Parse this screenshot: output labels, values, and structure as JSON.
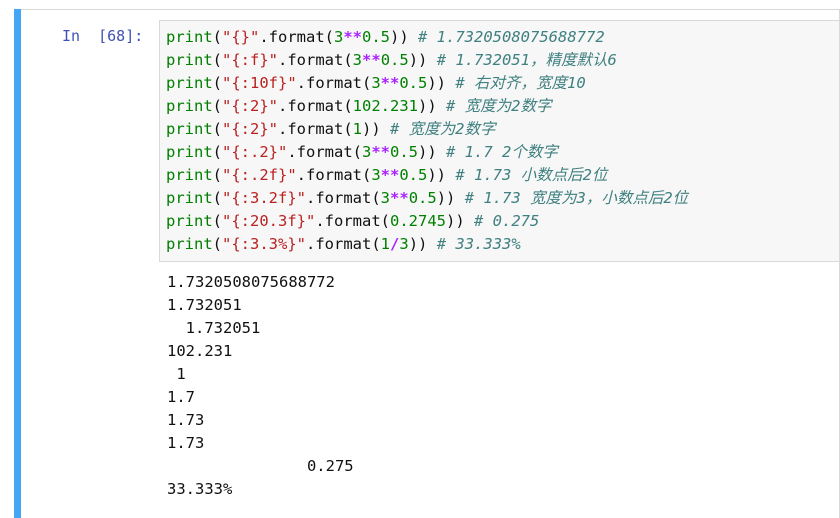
{
  "cell": {
    "prompt": "In  [68]:",
    "code_lines": [
      {
        "segments": [
          {
            "text": "print",
            "cls": "kw"
          },
          {
            "text": "(",
            "cls": ""
          },
          {
            "text": "\"{}\"",
            "cls": "str"
          },
          {
            "text": ".format(",
            "cls": ""
          },
          {
            "text": "3",
            "cls": "num"
          },
          {
            "text": "**",
            "cls": "op"
          },
          {
            "text": "0.5",
            "cls": "num"
          },
          {
            "text": ")) ",
            "cls": ""
          },
          {
            "text": "# 1.7320508075688772",
            "cls": "cm"
          }
        ]
      },
      {
        "segments": [
          {
            "text": "print",
            "cls": "kw"
          },
          {
            "text": "(",
            "cls": ""
          },
          {
            "text": "\"{:f}\"",
            "cls": "str"
          },
          {
            "text": ".format(",
            "cls": ""
          },
          {
            "text": "3",
            "cls": "num"
          },
          {
            "text": "**",
            "cls": "op"
          },
          {
            "text": "0.5",
            "cls": "num"
          },
          {
            "text": ")) ",
            "cls": ""
          },
          {
            "text": "# 1.732051，精度默认6",
            "cls": "cm"
          }
        ]
      },
      {
        "segments": [
          {
            "text": "print",
            "cls": "kw"
          },
          {
            "text": "(",
            "cls": ""
          },
          {
            "text": "\"{:10f}\"",
            "cls": "str"
          },
          {
            "text": ".format(",
            "cls": ""
          },
          {
            "text": "3",
            "cls": "num"
          },
          {
            "text": "**",
            "cls": "op"
          },
          {
            "text": "0.5",
            "cls": "num"
          },
          {
            "text": ")) ",
            "cls": ""
          },
          {
            "text": "# 右对齐，宽度10",
            "cls": "cm"
          }
        ]
      },
      {
        "segments": [
          {
            "text": "print",
            "cls": "kw"
          },
          {
            "text": "(",
            "cls": ""
          },
          {
            "text": "\"{:2}\"",
            "cls": "str"
          },
          {
            "text": ".format(",
            "cls": ""
          },
          {
            "text": "102.231",
            "cls": "num"
          },
          {
            "text": ")) ",
            "cls": ""
          },
          {
            "text": "# 宽度为2数字",
            "cls": "cm"
          }
        ]
      },
      {
        "segments": [
          {
            "text": "print",
            "cls": "kw"
          },
          {
            "text": "(",
            "cls": ""
          },
          {
            "text": "\"{:2}\"",
            "cls": "str"
          },
          {
            "text": ".format(",
            "cls": ""
          },
          {
            "text": "1",
            "cls": "num"
          },
          {
            "text": ")) ",
            "cls": ""
          },
          {
            "text": "# 宽度为2数字",
            "cls": "cm"
          }
        ]
      },
      {
        "segments": [
          {
            "text": "print",
            "cls": "kw"
          },
          {
            "text": "(",
            "cls": ""
          },
          {
            "text": "\"{:.2}\"",
            "cls": "str"
          },
          {
            "text": ".format(",
            "cls": ""
          },
          {
            "text": "3",
            "cls": "num"
          },
          {
            "text": "**",
            "cls": "op"
          },
          {
            "text": "0.5",
            "cls": "num"
          },
          {
            "text": ")) ",
            "cls": ""
          },
          {
            "text": "# 1.7 2个数字",
            "cls": "cm"
          }
        ]
      },
      {
        "segments": [
          {
            "text": "print",
            "cls": "kw"
          },
          {
            "text": "(",
            "cls": ""
          },
          {
            "text": "\"{:.2f}\"",
            "cls": "str"
          },
          {
            "text": ".format(",
            "cls": ""
          },
          {
            "text": "3",
            "cls": "num"
          },
          {
            "text": "**",
            "cls": "op"
          },
          {
            "text": "0.5",
            "cls": "num"
          },
          {
            "text": ")) ",
            "cls": ""
          },
          {
            "text": "# 1.73 小数点后2位",
            "cls": "cm"
          }
        ]
      },
      {
        "segments": [
          {
            "text": "print",
            "cls": "kw"
          },
          {
            "text": "(",
            "cls": ""
          },
          {
            "text": "\"{:3.2f}\"",
            "cls": "str"
          },
          {
            "text": ".format(",
            "cls": ""
          },
          {
            "text": "3",
            "cls": "num"
          },
          {
            "text": "**",
            "cls": "op"
          },
          {
            "text": "0.5",
            "cls": "num"
          },
          {
            "text": ")) ",
            "cls": ""
          },
          {
            "text": "# 1.73 宽度为3，小数点后2位",
            "cls": "cm"
          }
        ]
      },
      {
        "segments": [
          {
            "text": "print",
            "cls": "kw"
          },
          {
            "text": "(",
            "cls": ""
          },
          {
            "text": "\"{:20.3f}\"",
            "cls": "str"
          },
          {
            "text": ".format(",
            "cls": ""
          },
          {
            "text": "0.2745",
            "cls": "num"
          },
          {
            "text": ")) ",
            "cls": ""
          },
          {
            "text": "# 0.275",
            "cls": "cm"
          }
        ]
      },
      {
        "segments": [
          {
            "text": "print",
            "cls": "kw"
          },
          {
            "text": "(",
            "cls": ""
          },
          {
            "text": "\"{:3.3%}\"",
            "cls": "str"
          },
          {
            "text": ".format(",
            "cls": ""
          },
          {
            "text": "1",
            "cls": "num"
          },
          {
            "text": "/",
            "cls": "op"
          },
          {
            "text": "3",
            "cls": "num"
          },
          {
            "text": ")) ",
            "cls": ""
          },
          {
            "text": "# 33.333%",
            "cls": "cm"
          }
        ]
      }
    ],
    "output_lines": [
      "1.7320508075688772",
      "1.732051",
      "  1.732051",
      "102.231",
      " 1",
      "1.7",
      "1.73",
      "1.73",
      "               0.275",
      "33.333%"
    ]
  },
  "colors": {
    "selection_bar": "#42a5f5",
    "prompt": "#3f51b5",
    "keyword": "#008000",
    "string": "#ba2121",
    "number": "#008000",
    "operator": "#aa22ff",
    "comment": "#408080",
    "input_background": "#f7f7f7"
  }
}
